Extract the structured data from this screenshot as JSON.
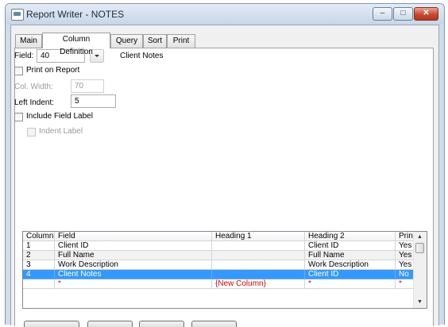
{
  "window": {
    "title": "Report Writer - NOTES",
    "minimize_glyph": "–",
    "maximize_glyph": "□",
    "close_glyph": "✕"
  },
  "tabs": [
    "Main",
    "Column Definition",
    "Query",
    "Sort",
    "Print"
  ],
  "active_tab": "Column Definition",
  "form": {
    "field_label": "Field:",
    "field_value": "40",
    "field_description": "Client Notes",
    "print_on_report_label": "Print on Report",
    "print_on_report_checked": false,
    "col_width_label": "Col. Width:",
    "col_width_value": "70",
    "left_indent_label": "Left Indent:",
    "left_indent_value": "5",
    "include_field_label_label": "Include Field Label",
    "include_field_label_checked": false,
    "indent_label_label": "Indent Label",
    "indent_label_checked": false
  },
  "grid": {
    "columns": [
      "Column",
      "Field",
      "Heading 1",
      "Heading 2",
      "Print"
    ],
    "rows": [
      {
        "column": "1",
        "field": "Client ID",
        "heading1": "",
        "heading2": "Client ID",
        "print": "Yes"
      },
      {
        "column": "2",
        "field": "Full Name",
        "heading1": "",
        "heading2": "Full Name",
        "print": "Yes"
      },
      {
        "column": "3",
        "field": "Work Description",
        "heading1": "",
        "heading2": "Work Description",
        "print": "Yes"
      },
      {
        "column": "4",
        "field": "Client Notes",
        "heading1": "",
        "heading2": "Client ID",
        "print": "No"
      },
      {
        "column": "",
        "field": "*",
        "heading1": "{New Column}",
        "heading2": "*",
        "print": "*"
      }
    ],
    "selected_row": 4,
    "scroll_up_glyph": "▲",
    "scroll_down_glyph": "▼"
  },
  "colors": {
    "selection": "#3399ff",
    "new_row_text": "#e00000",
    "titlebar": "#d6e2ef"
  }
}
